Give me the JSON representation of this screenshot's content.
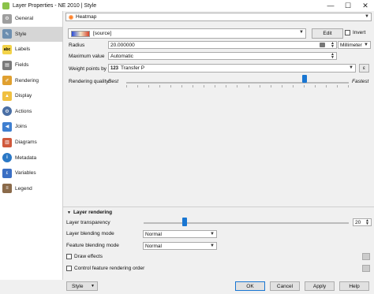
{
  "window": {
    "title": "Layer Properties - NE 2010 | Style",
    "min": "—",
    "max": "☐",
    "close": "✕"
  },
  "sidebar": {
    "items": [
      {
        "label": "General",
        "icon": "general-icon"
      },
      {
        "label": "Style",
        "icon": "style-icon"
      },
      {
        "label": "Labels",
        "icon": "labels-icon",
        "badge": "abc"
      },
      {
        "label": "Fields",
        "icon": "fields-icon"
      },
      {
        "label": "Rendering",
        "icon": "rendering-icon"
      },
      {
        "label": "Display",
        "icon": "display-icon"
      },
      {
        "label": "Actions",
        "icon": "actions-icon"
      },
      {
        "label": "Joins",
        "icon": "joins-icon"
      },
      {
        "label": "Diagrams",
        "icon": "diagrams-icon"
      },
      {
        "label": "Metadata",
        "icon": "metadata-icon",
        "badge": "i"
      },
      {
        "label": "Variables",
        "icon": "variables-icon"
      },
      {
        "label": "Legend",
        "icon": "legend-icon"
      }
    ],
    "active": "Style"
  },
  "renderer": {
    "selected": "Heatmap"
  },
  "ramp": {
    "text": "[source]",
    "edit_label": "Edit",
    "invert_label": "Invert"
  },
  "form": {
    "radius_label": "Radius",
    "radius_value": "20.000000",
    "unit": "Millimeter",
    "maxval_label": "Maximum value",
    "maxval_value": "Automatic",
    "weight_label": "Weight points by",
    "weight_badge": "123",
    "weight_value": "Transfer P",
    "expr_label": "ε",
    "quality_label": "Rendering quality",
    "quality_best": "Best",
    "quality_fast": "Fastest",
    "quality_level": 0.8
  },
  "layer_rendering": {
    "header": "Layer rendering",
    "transparency_label": "Layer transparency",
    "transparency_value": "20",
    "transparency_level": 0.2,
    "layer_blend_label": "Layer blending mode",
    "layer_blend_value": "Normal",
    "feature_blend_label": "Feature blending mode",
    "feature_blend_value": "Normal",
    "draw_effects_label": "Draw effects",
    "control_order_label": "Control feature rendering order"
  },
  "buttons": {
    "style": "Style",
    "ok": "OK",
    "cancel": "Cancel",
    "apply": "Apply",
    "help": "Help"
  },
  "colors": {
    "accent": "#1976d2",
    "active_item": "#d6d6d6"
  }
}
